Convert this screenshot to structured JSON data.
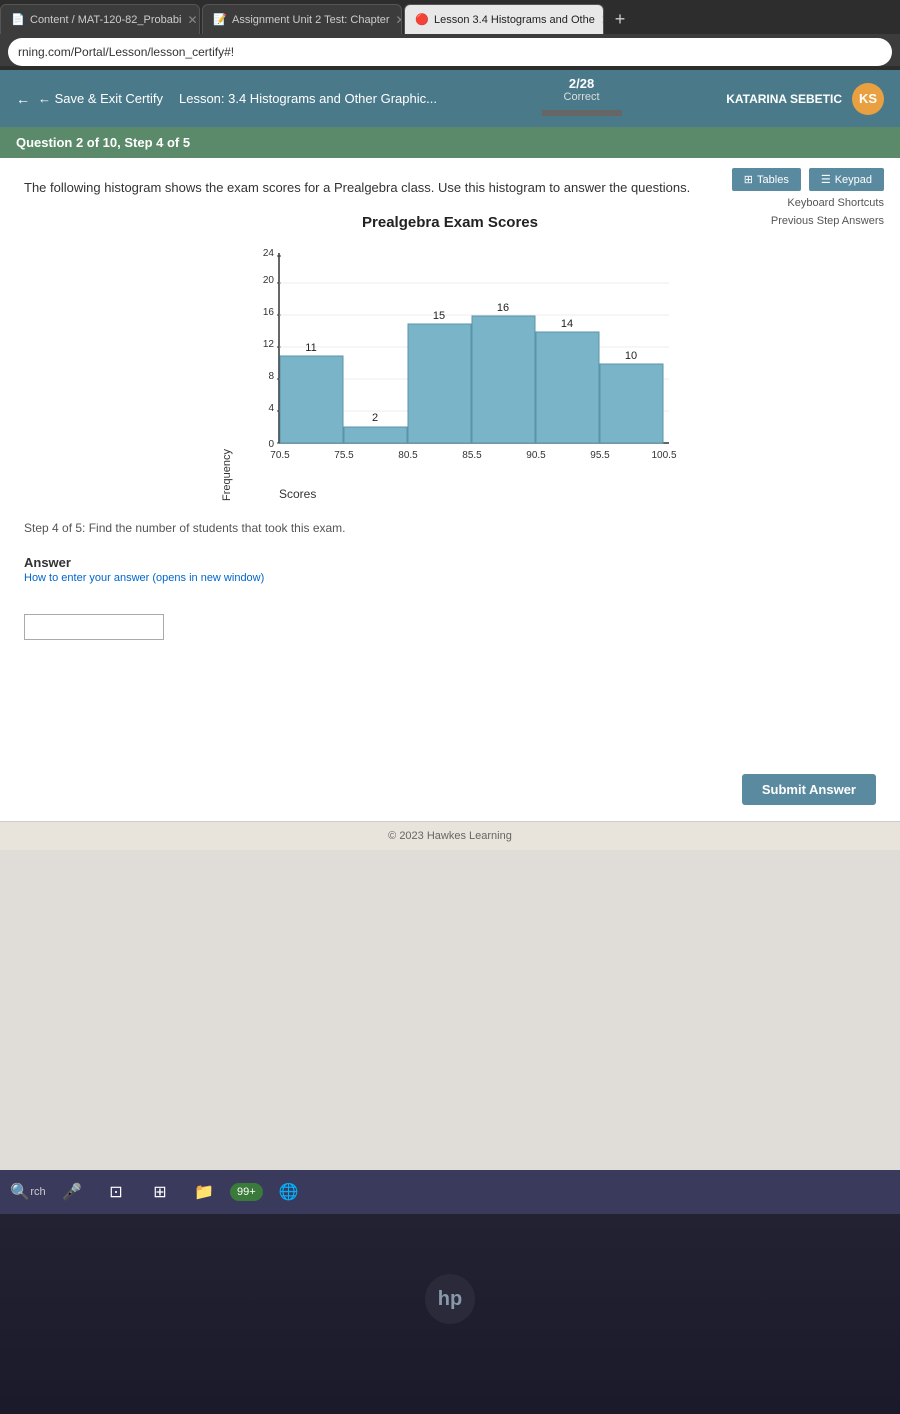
{
  "browser": {
    "tabs": [
      {
        "id": "tab1",
        "label": "Content / MAT-120-82_Probabi",
        "icon": "document-icon",
        "active": false,
        "closeable": true
      },
      {
        "id": "tab2",
        "label": "Assignment Unit 2 Test: Chapter",
        "icon": "assignment-icon",
        "active": false,
        "closeable": true
      },
      {
        "id": "tab3",
        "label": "Lesson 3.4 Histograms and Othe",
        "icon": "lesson-icon",
        "active": true,
        "closeable": true
      }
    ],
    "address": "rning.com/Portal/Lesson/lesson_certify#!"
  },
  "topnav": {
    "save_exit_label": "← Save & Exit Certify",
    "lesson_title": "Lesson: 3.4 Histograms and Other Graphic...",
    "score": "2/28",
    "correct_label": "Correct",
    "user_name": "KATARINA SEBETIC",
    "user_initials": "KS"
  },
  "question": {
    "header": "Question 2 of 10, Step 4 of 5",
    "text": "The following histogram shows the exam scores for a Prealgebra class. Use this histogram to answer the questions.",
    "chart_title": "Prealgebra Exam Scores",
    "x_axis_label": "Scores",
    "y_axis_label": "Frequency",
    "bars": [
      {
        "label": "70.5–75.5",
        "value": 11,
        "height_pct": 45.8
      },
      {
        "label": "75.5–80.5",
        "value": 2,
        "height_pct": 8.3
      },
      {
        "label": "80.5–85.5",
        "value": 15,
        "height_pct": 62.5
      },
      {
        "label": "85.5–90.5",
        "value": 16,
        "height_pct": 66.7
      },
      {
        "label": "90.5–95.5",
        "value": 14,
        "height_pct": 58.3
      },
      {
        "label": "95.5–100.5",
        "value": 10,
        "height_pct": 41.7
      }
    ],
    "x_ticks": [
      "70.5",
      "75.5",
      "80.5",
      "85.5",
      "90.5",
      "95.5",
      "100.5"
    ],
    "y_ticks": [
      0,
      4,
      8,
      12,
      16,
      20,
      24
    ],
    "step_instruction": "Step 4 of 5:  Find the number of students that took this exam.",
    "answer_label": "Answer",
    "answer_hint": "How to enter your answer (opens in new window)",
    "answer_placeholder": ""
  },
  "tools": {
    "tables_label": "Tables",
    "keypad_label": "Keypad",
    "keyboard_shortcuts_label": "Keyboard Shortcuts",
    "previous_step_label": "Previous Step Answers"
  },
  "submit": {
    "label": "Submit Answer"
  },
  "footer": {
    "copyright": "© 2023 Hawkes Learning"
  },
  "taskbar": {
    "badge_label": "99+"
  }
}
